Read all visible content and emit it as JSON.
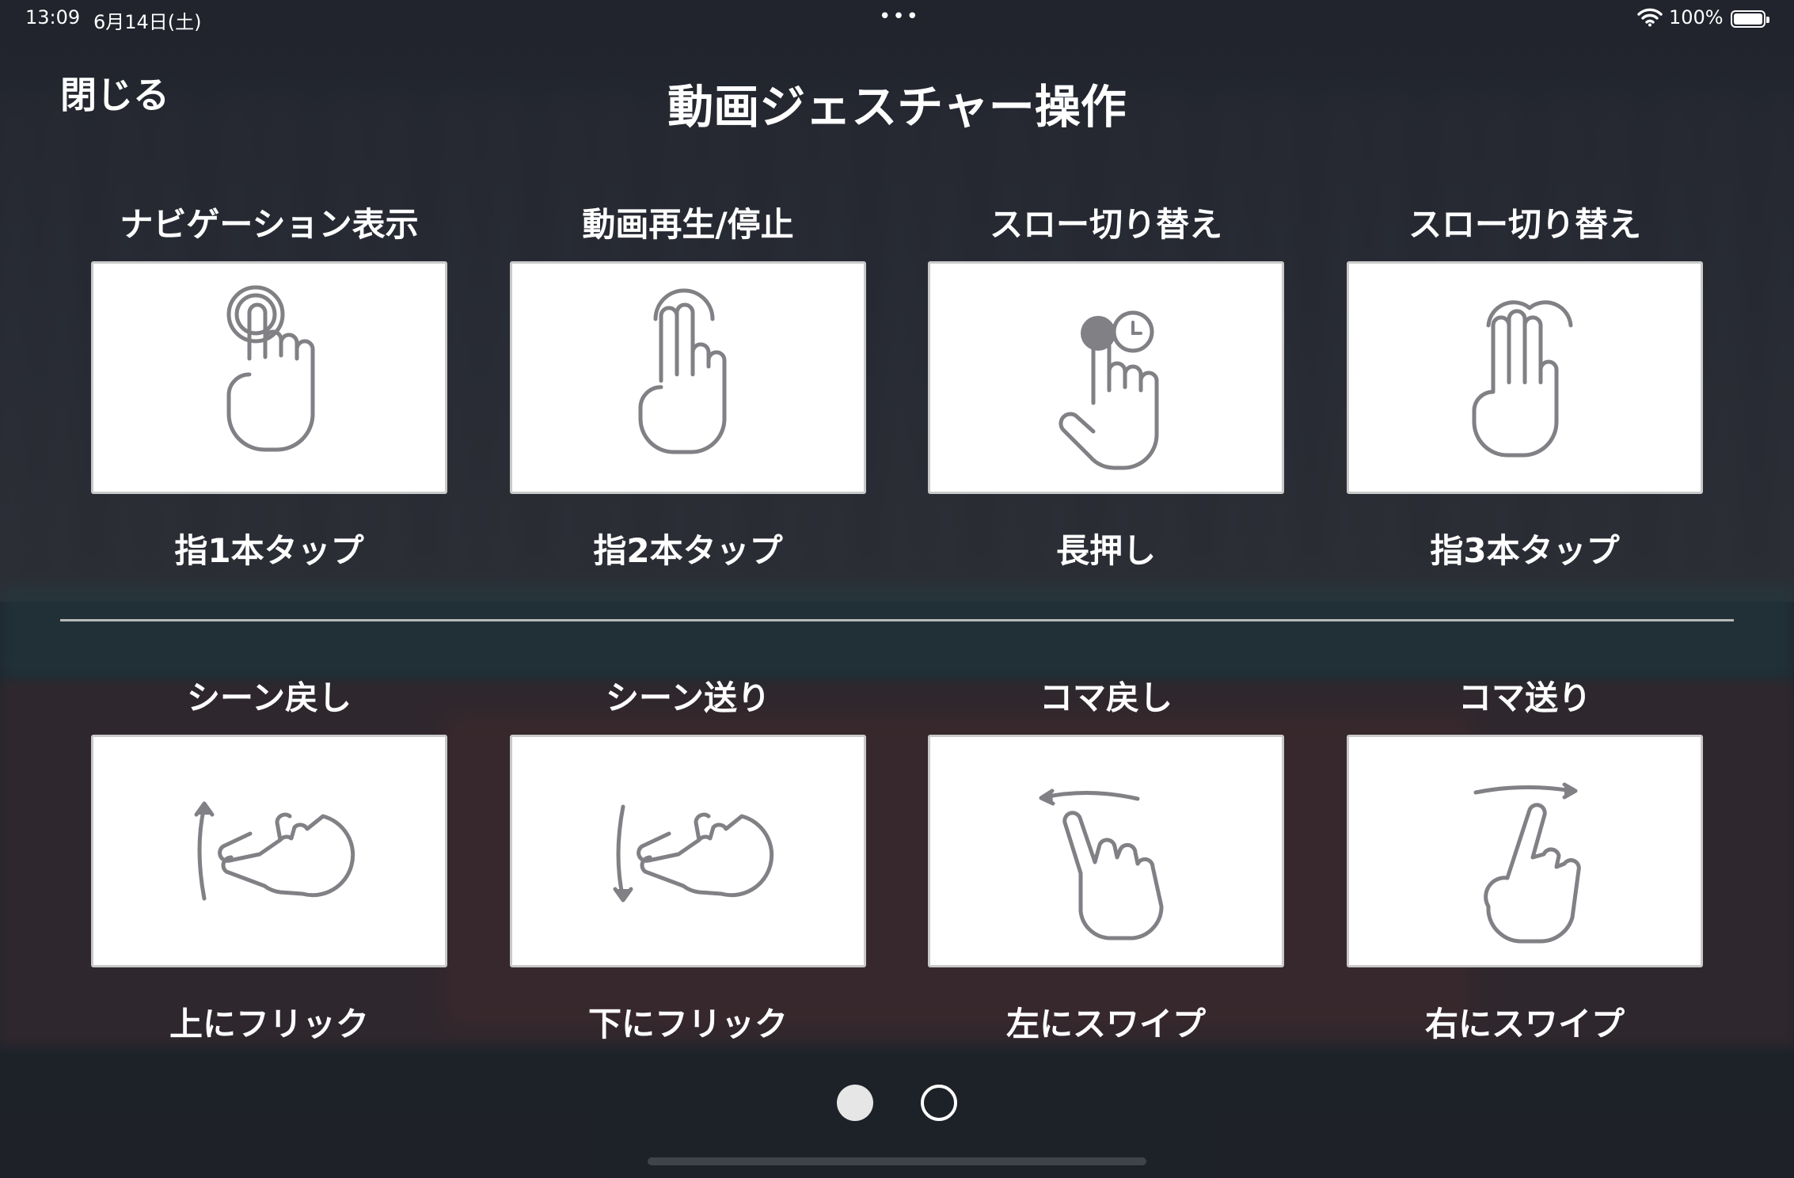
{
  "status_bar": {
    "time": "13:09",
    "date": "6月14日(土)",
    "dots": "•••",
    "battery_text": "100%",
    "wifi_icon": "wifi-icon",
    "battery_icon": "battery-icon"
  },
  "header": {
    "close_label": "閉じる",
    "title": "動画ジェスチャー操作"
  },
  "gestures": [
    {
      "action": "ナビゲーション表示",
      "gesture": "指1本タップ",
      "icon": "one-finger-tap-icon"
    },
    {
      "action": "動画再生/停止",
      "gesture": "指2本タップ",
      "icon": "two-finger-tap-icon"
    },
    {
      "action": "スロー切り替え",
      "gesture": "長押し",
      "icon": "long-press-icon"
    },
    {
      "action": "スロー切り替え",
      "gesture": "指3本タップ",
      "icon": "three-finger-tap-icon"
    },
    {
      "action": "シーン戻し",
      "gesture": "上にフリック",
      "icon": "flick-up-icon"
    },
    {
      "action": "シーン送り",
      "gesture": "下にフリック",
      "icon": "flick-down-icon"
    },
    {
      "action": "コマ戻し",
      "gesture": "左にスワイプ",
      "icon": "swipe-left-icon"
    },
    {
      "action": "コマ送り",
      "gesture": "右にスワイプ",
      "icon": "swipe-right-icon"
    }
  ],
  "pagination": {
    "current_page": 1,
    "total_pages": 2
  },
  "colors": {
    "icon_stroke": "#808085",
    "panel_bg": "#ffffff",
    "text": "#ffffff"
  }
}
